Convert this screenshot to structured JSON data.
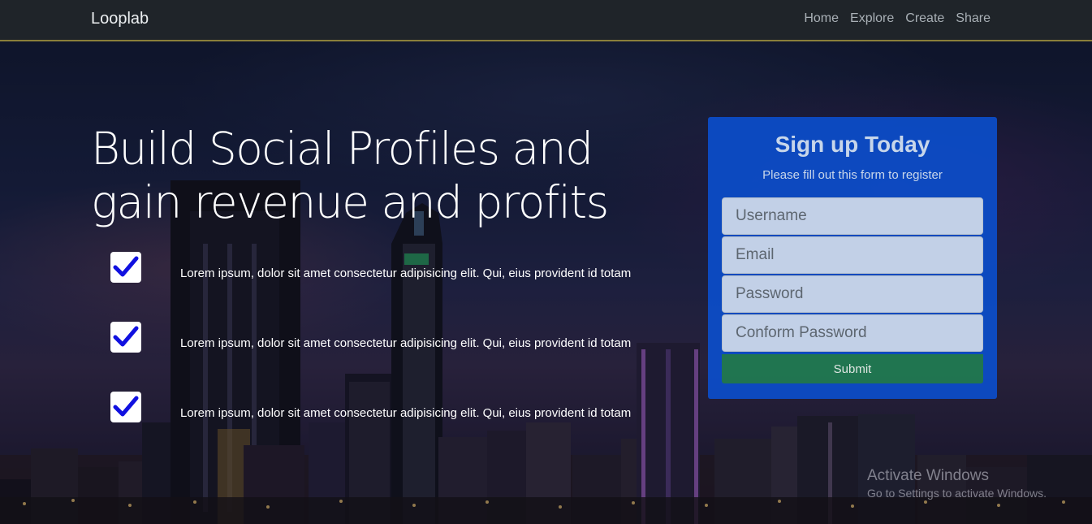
{
  "navbar": {
    "brand": "Looplab",
    "links": [
      "Home",
      "Explore",
      "Create",
      "Share"
    ]
  },
  "hero": {
    "title": "Build Social Profiles and gain revenue and profits",
    "features": [
      "Lorem ipsum, dolor sit amet consectetur adipisicing elit. Qui, eius provident id totam",
      "Lorem ipsum, dolor sit amet consectetur adipisicing elit. Qui, eius provident id totam",
      "Lorem ipsum, dolor sit amet consectetur adipisicing elit. Qui, eius provident id totam"
    ]
  },
  "signup": {
    "title": "Sign up Today",
    "subtitle": "Please fill out this form to register",
    "username_placeholder": "Username",
    "email_placeholder": "Email",
    "password_placeholder": "Password",
    "confirm_placeholder": "Conform Password",
    "submit_label": "Submit"
  },
  "watermark": {
    "line1": "Activate Windows",
    "line2": "Go to Settings to activate Windows."
  },
  "colors": {
    "navbar_bg": "#1f2429",
    "card_bg": "#0a50d2",
    "submit_bg": "#22784a",
    "check_color": "#1010e0"
  },
  "icons": {
    "feature_check": "check-icon",
    "background": "city-skyline-night"
  }
}
